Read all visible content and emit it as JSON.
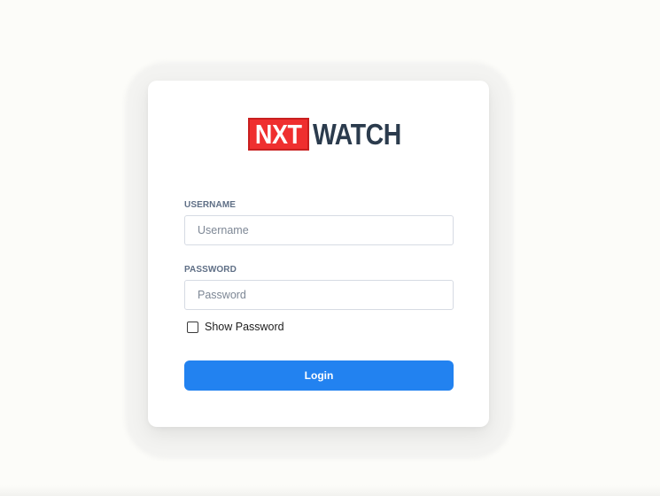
{
  "colors": {
    "page_background": "#fcfcf9",
    "card_background": "#ffffff",
    "logo_red": "#ef2f2f",
    "logo_dark": "#2b3b4d",
    "label_color": "#5f6f86",
    "button_blue": "#2282f0"
  },
  "logo": {
    "part1": "NXT",
    "part2": "WATCH"
  },
  "form": {
    "username": {
      "label": "USERNAME",
      "placeholder": "Username",
      "value": ""
    },
    "password": {
      "label": "PASSWORD",
      "placeholder": "Password",
      "value": ""
    },
    "show_password": {
      "label": "Show Password",
      "checked": false
    },
    "login_label": "Login"
  }
}
